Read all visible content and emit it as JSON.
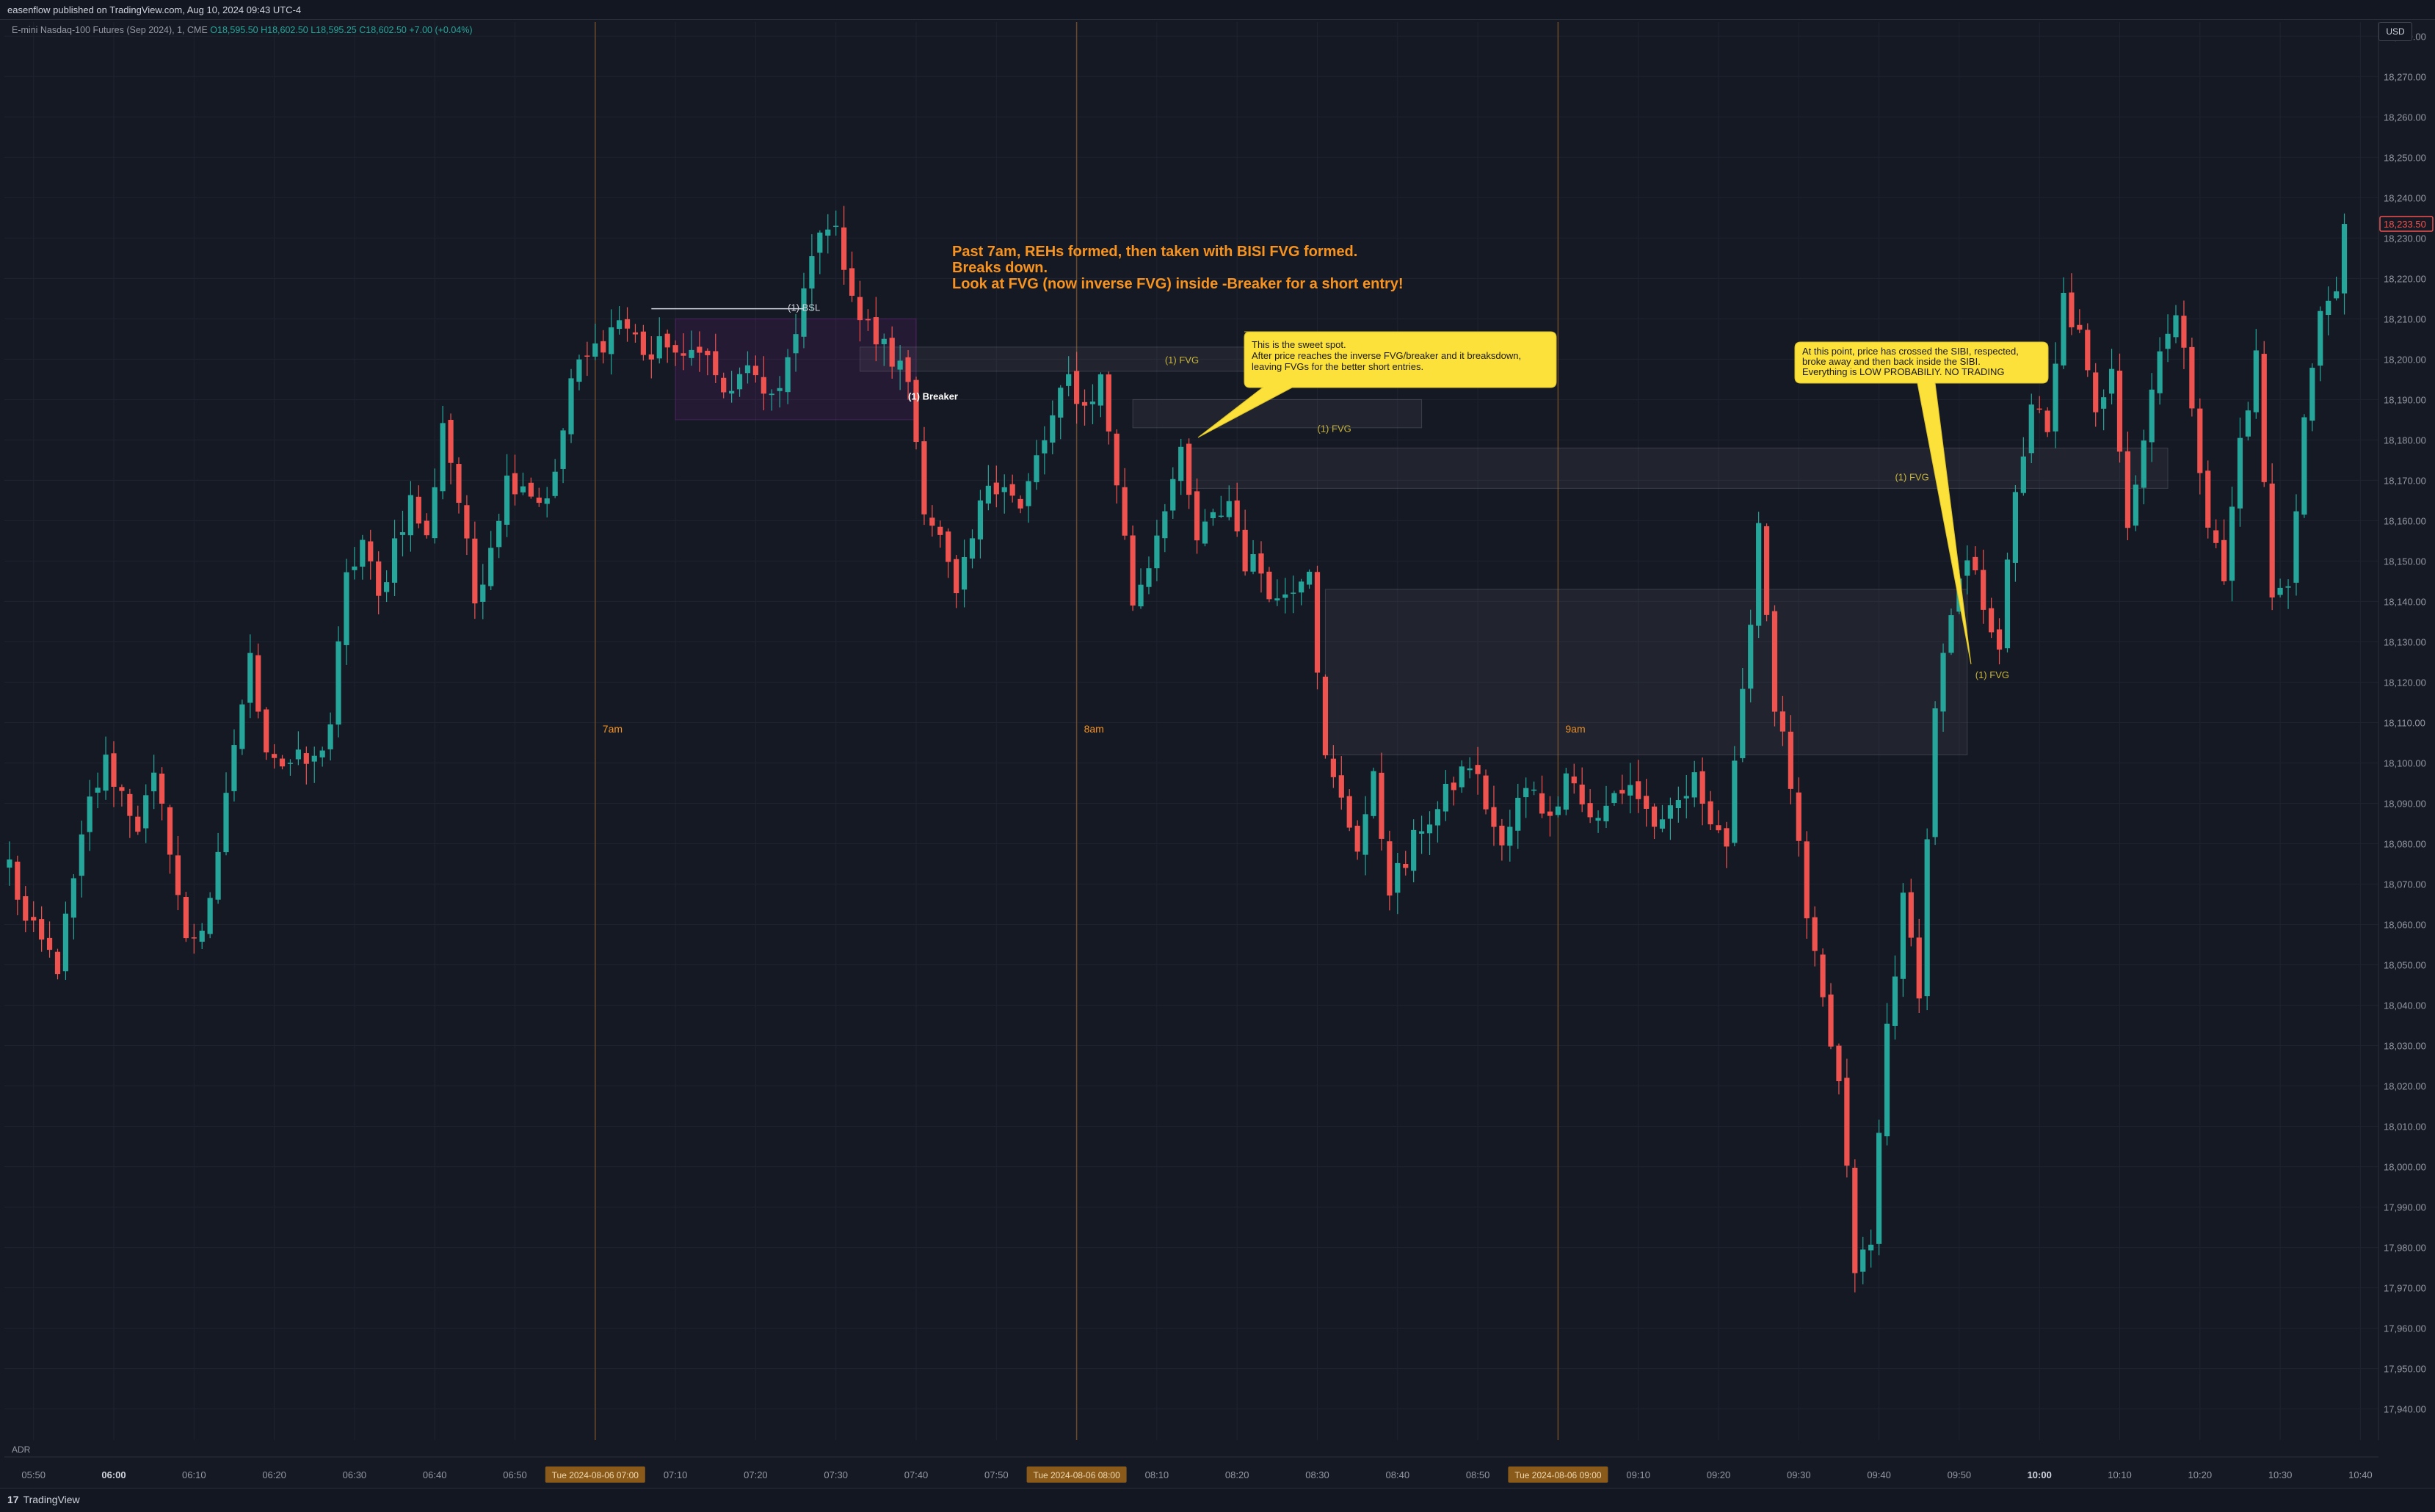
{
  "header": {
    "published": "easenflow published on TradingView.com, Aug 10, 2024 09:43 UTC-4",
    "symbol": "E-mini Nasdaq-100 Futures (Sep 2024), 1, CME",
    "ohlc": "O18,595.50 H18,602.50 L18,595.25 C18,602.50 +7.00 (+0.04%)"
  },
  "currency_button": "USD",
  "indicator_pane_label": "ADR",
  "footer": {
    "brand": "TradingView",
    "logo_text": "17"
  },
  "colors": {
    "up": "#26a69a",
    "down": "#ef5350",
    "background": "#151924",
    "annotation": "#f7931e",
    "callout": "#fde13b"
  },
  "chart_data": {
    "type": "candlestick",
    "timeframe": "1 minute",
    "ylim": [
      17935,
      18290
    ],
    "price_ticks": [
      17940,
      17950,
      17960,
      17970,
      17980,
      17990,
      18000,
      18010,
      18020,
      18030,
      18040,
      18050,
      18060,
      18070,
      18080,
      18090,
      18100,
      18110,
      18120,
      18130,
      18140,
      18150,
      18160,
      18170,
      18180,
      18190,
      18200,
      18210,
      18220,
      18230,
      18240,
      18250,
      18260,
      18270,
      18280
    ],
    "price_tick_labels": [
      "17,940.00",
      "17,950.00",
      "17,960.00",
      "17,970.00",
      "17,980.00",
      "17,990.00",
      "18,000.00",
      "18,010.00",
      "18,020.00",
      "18,030.00",
      "18,040.00",
      "18,050.00",
      "18,060.00",
      "18,070.00",
      "18,080.00",
      "18,090.00",
      "18,100.00",
      "18,110.00",
      "18,120.00",
      "18,130.00",
      "18,140.00",
      "18,150.00",
      "18,160.00",
      "18,170.00",
      "18,180.00",
      "18,190.00",
      "18,200.00",
      "18,210.00",
      "18,220.00",
      "18,230.00",
      "18,240.00",
      "18,250.00",
      "18,260.00",
      "18,270.00",
      "18,280.00"
    ],
    "last_price_label": "18,233.50",
    "time_ticks": [
      {
        "t": -10,
        "label": "05:50",
        "bold": false
      },
      {
        "t": 0,
        "label": "06:00",
        "bold": true
      },
      {
        "t": 10,
        "label": "06:10",
        "bold": false
      },
      {
        "t": 20,
        "label": "06:20",
        "bold": false
      },
      {
        "t": 30,
        "label": "06:30",
        "bold": false
      },
      {
        "t": 40,
        "label": "06:40",
        "bold": false
      },
      {
        "t": 50,
        "label": "06:50",
        "bold": false
      },
      {
        "t": 70,
        "label": "07:10",
        "bold": false
      },
      {
        "t": 80,
        "label": "07:20",
        "bold": false
      },
      {
        "t": 90,
        "label": "07:30",
        "bold": false
      },
      {
        "t": 100,
        "label": "07:40",
        "bold": false
      },
      {
        "t": 110,
        "label": "07:50",
        "bold": false
      },
      {
        "t": 130,
        "label": "08:10",
        "bold": false
      },
      {
        "t": 140,
        "label": "08:20",
        "bold": false
      },
      {
        "t": 150,
        "label": "08:30",
        "bold": false
      },
      {
        "t": 160,
        "label": "08:40",
        "bold": false
      },
      {
        "t": 170,
        "label": "08:50",
        "bold": false
      },
      {
        "t": 190,
        "label": "09:10",
        "bold": false
      },
      {
        "t": 200,
        "label": "09:20",
        "bold": false
      },
      {
        "t": 210,
        "label": "09:30",
        "bold": false
      },
      {
        "t": 220,
        "label": "09:40",
        "bold": false
      },
      {
        "t": 230,
        "label": "09:50",
        "bold": false
      },
      {
        "t": 240,
        "label": "10:00",
        "bold": true
      },
      {
        "t": 250,
        "label": "10:10",
        "bold": false
      },
      {
        "t": 260,
        "label": "10:20",
        "bold": false
      },
      {
        "t": 270,
        "label": "10:30",
        "bold": false
      },
      {
        "t": 280,
        "label": "10:40",
        "bold": false
      }
    ],
    "session_markers": [
      {
        "t": 60,
        "label": "7am",
        "tag": "Tue 2024-08-06 07:00"
      },
      {
        "t": 120,
        "label": "8am",
        "tag": "Tue 2024-08-06 08:00"
      },
      {
        "t": 180,
        "label": "9am",
        "tag": "Tue 2024-08-06 09:00"
      }
    ],
    "keypoints": [
      [
        -13,
        18075
      ],
      [
        -11,
        18060
      ],
      [
        -7,
        18050
      ],
      [
        -3,
        18090
      ],
      [
        -1,
        18100
      ],
      [
        3,
        18085
      ],
      [
        5,
        18095
      ],
      [
        7,
        18080
      ],
      [
        9,
        18055
      ],
      [
        11,
        18060
      ],
      [
        13,
        18075
      ],
      [
        15,
        18105
      ],
      [
        17,
        18125
      ],
      [
        19,
        18105
      ],
      [
        21,
        18100
      ],
      [
        25,
        18100
      ],
      [
        27,
        18110
      ],
      [
        29,
        18145
      ],
      [
        31,
        18155
      ],
      [
        33,
        18140
      ],
      [
        35,
        18155
      ],
      [
        37,
        18165
      ],
      [
        39,
        18155
      ],
      [
        41,
        18185
      ],
      [
        43,
        18165
      ],
      [
        45,
        18140
      ],
      [
        47,
        18155
      ],
      [
        49,
        18170
      ],
      [
        51,
        18170
      ],
      [
        53,
        18165
      ],
      [
        55,
        18170
      ],
      [
        57,
        18195
      ],
      [
        59,
        18200
      ],
      [
        61,
        18205
      ],
      [
        63,
        18210
      ],
      [
        65,
        18205
      ],
      [
        67,
        18200
      ],
      [
        69,
        18205
      ],
      [
        71,
        18198
      ],
      [
        73,
        18205
      ],
      [
        75,
        18195
      ],
      [
        77,
        18190
      ],
      [
        79,
        18200
      ],
      [
        81,
        18188
      ],
      [
        83,
        18195
      ],
      [
        85,
        18205
      ],
      [
        87,
        18225
      ],
      [
        89,
        18235
      ],
      [
        91,
        18225
      ],
      [
        93,
        18210
      ],
      [
        95,
        18205
      ],
      [
        97,
        18200
      ],
      [
        99,
        18195
      ],
      [
        101,
        18165
      ],
      [
        103,
        18155
      ],
      [
        105,
        18140
      ],
      [
        107,
        18155
      ],
      [
        109,
        18170
      ],
      [
        111,
        18170
      ],
      [
        113,
        18162
      ],
      [
        115,
        18175
      ],
      [
        117,
        18185
      ],
      [
        119,
        18195
      ],
      [
        121,
        18188
      ],
      [
        123,
        18195
      ],
      [
        125,
        18170
      ],
      [
        127,
        18140
      ],
      [
        129,
        18150
      ],
      [
        131,
        18165
      ],
      [
        133,
        18175
      ],
      [
        135,
        18155
      ],
      [
        137,
        18160
      ],
      [
        139,
        18165
      ],
      [
        141,
        18150
      ],
      [
        143,
        18148
      ],
      [
        145,
        18140
      ],
      [
        147,
        18145
      ],
      [
        149,
        18150
      ],
      [
        151,
        18100
      ],
      [
        153,
        18090
      ],
      [
        155,
        18080
      ],
      [
        157,
        18095
      ],
      [
        159,
        18070
      ],
      [
        161,
        18075
      ],
      [
        163,
        18085
      ],
      [
        165,
        18088
      ],
      [
        167,
        18095
      ],
      [
        169,
        18100
      ],
      [
        171,
        18090
      ],
      [
        173,
        18078
      ],
      [
        175,
        18090
      ],
      [
        177,
        18095
      ],
      [
        179,
        18085
      ],
      [
        181,
        18100
      ],
      [
        183,
        18090
      ],
      [
        185,
        18085
      ],
      [
        187,
        18092
      ],
      [
        189,
        18095
      ],
      [
        191,
        18088
      ],
      [
        193,
        18083
      ],
      [
        195,
        18090
      ],
      [
        197,
        18095
      ],
      [
        199,
        18088
      ],
      [
        201,
        18080
      ],
      [
        203,
        18115
      ],
      [
        205,
        18160
      ],
      [
        207,
        18115
      ],
      [
        209,
        18095
      ],
      [
        211,
        18060
      ],
      [
        213,
        18040
      ],
      [
        215,
        18020
      ],
      [
        217,
        17975
      ],
      [
        219,
        17980
      ],
      [
        221,
        18035
      ],
      [
        223,
        18065
      ],
      [
        225,
        18045
      ],
      [
        227,
        18115
      ],
      [
        229,
        18135
      ],
      [
        231,
        18150
      ],
      [
        233,
        18140
      ],
      [
        235,
        18130
      ],
      [
        237,
        18165
      ],
      [
        239,
        18190
      ],
      [
        241,
        18180
      ],
      [
        243,
        18215
      ],
      [
        245,
        18205
      ],
      [
        247,
        18185
      ],
      [
        249,
        18200
      ],
      [
        251,
        18160
      ],
      [
        253,
        18180
      ],
      [
        255,
        18205
      ],
      [
        257,
        18210
      ],
      [
        259,
        18190
      ],
      [
        261,
        18160
      ],
      [
        263,
        18145
      ],
      [
        265,
        18180
      ],
      [
        267,
        18200
      ],
      [
        269,
        18140
      ],
      [
        271,
        18145
      ],
      [
        273,
        18185
      ],
      [
        275,
        18210
      ],
      [
        277,
        18220
      ],
      [
        278,
        18233.5
      ]
    ],
    "zones": [
      {
        "name": "breaker-zone",
        "t1": 70,
        "t2": 100,
        "p1": 18185,
        "p2": 18210,
        "color": "#9c27b0"
      },
      {
        "name": "fvg-zone-1",
        "t1": 93,
        "t2": 143,
        "p1": 18197,
        "p2": 18203,
        "color": "#787b86"
      },
      {
        "name": "fvg-zone-2",
        "t1": 127,
        "t2": 163,
        "p1": 18183,
        "p2": 18190,
        "color": "#787b86"
      },
      {
        "name": "fvg-zone-3",
        "t1": 134,
        "t2": 256,
        "p1": 18168,
        "p2": 18178,
        "color": "#787b86"
      },
      {
        "name": "fvg-zone-4",
        "t1": 151,
        "t2": 231,
        "p1": 18102,
        "p2": 18143,
        "color": "#787b86"
      }
    ],
    "labels": [
      {
        "name": "label-bsl",
        "text": "(1) BSL",
        "t": 84,
        "p": 18212,
        "color": "#d1d4dc"
      },
      {
        "name": "label-breaker",
        "text": "(1) Breaker",
        "t": 99,
        "p": 18190,
        "color": "#ffffff",
        "bold": true
      },
      {
        "name": "label-fvg-1",
        "text": "(1) FVG",
        "t": 131,
        "p": 18199,
        "color": "#c9b53a"
      },
      {
        "name": "label-fvg-2",
        "text": "(1) FVG",
        "t": 150,
        "p": 18182,
        "color": "#c9b53a"
      },
      {
        "name": "label-fvg-3",
        "text": "(1) FVG",
        "t": 222,
        "p": 18170,
        "color": "#c9b53a"
      },
      {
        "name": "label-fvg-4",
        "text": "(1) FVG",
        "t": 232,
        "p": 18121,
        "color": "#c9b53a"
      }
    ],
    "bsl_line": {
      "t1": 67,
      "t2": 86,
      "p": 18212.5
    },
    "annotations": {
      "main": [
        "Past 7am, REHs formed, then taken with BISI FVG formed.",
        "Breaks down.",
        "Look at FVG (now inverse FVG) inside -Breaker for a short entry!"
      ],
      "callout_sweet_spot": [
        "This is the sweet spot.",
        "After price reaches the inverse FVG/breaker and it breaksdown,",
        "leaving FVGs for the better short entries."
      ],
      "callout_no_trading": [
        "At this point, price has crossed the SIBI, respected,",
        "broke away and then back inside the SIBI.",
        "Everything is LOW PROBABILIY.  NO TRADING"
      ]
    }
  }
}
